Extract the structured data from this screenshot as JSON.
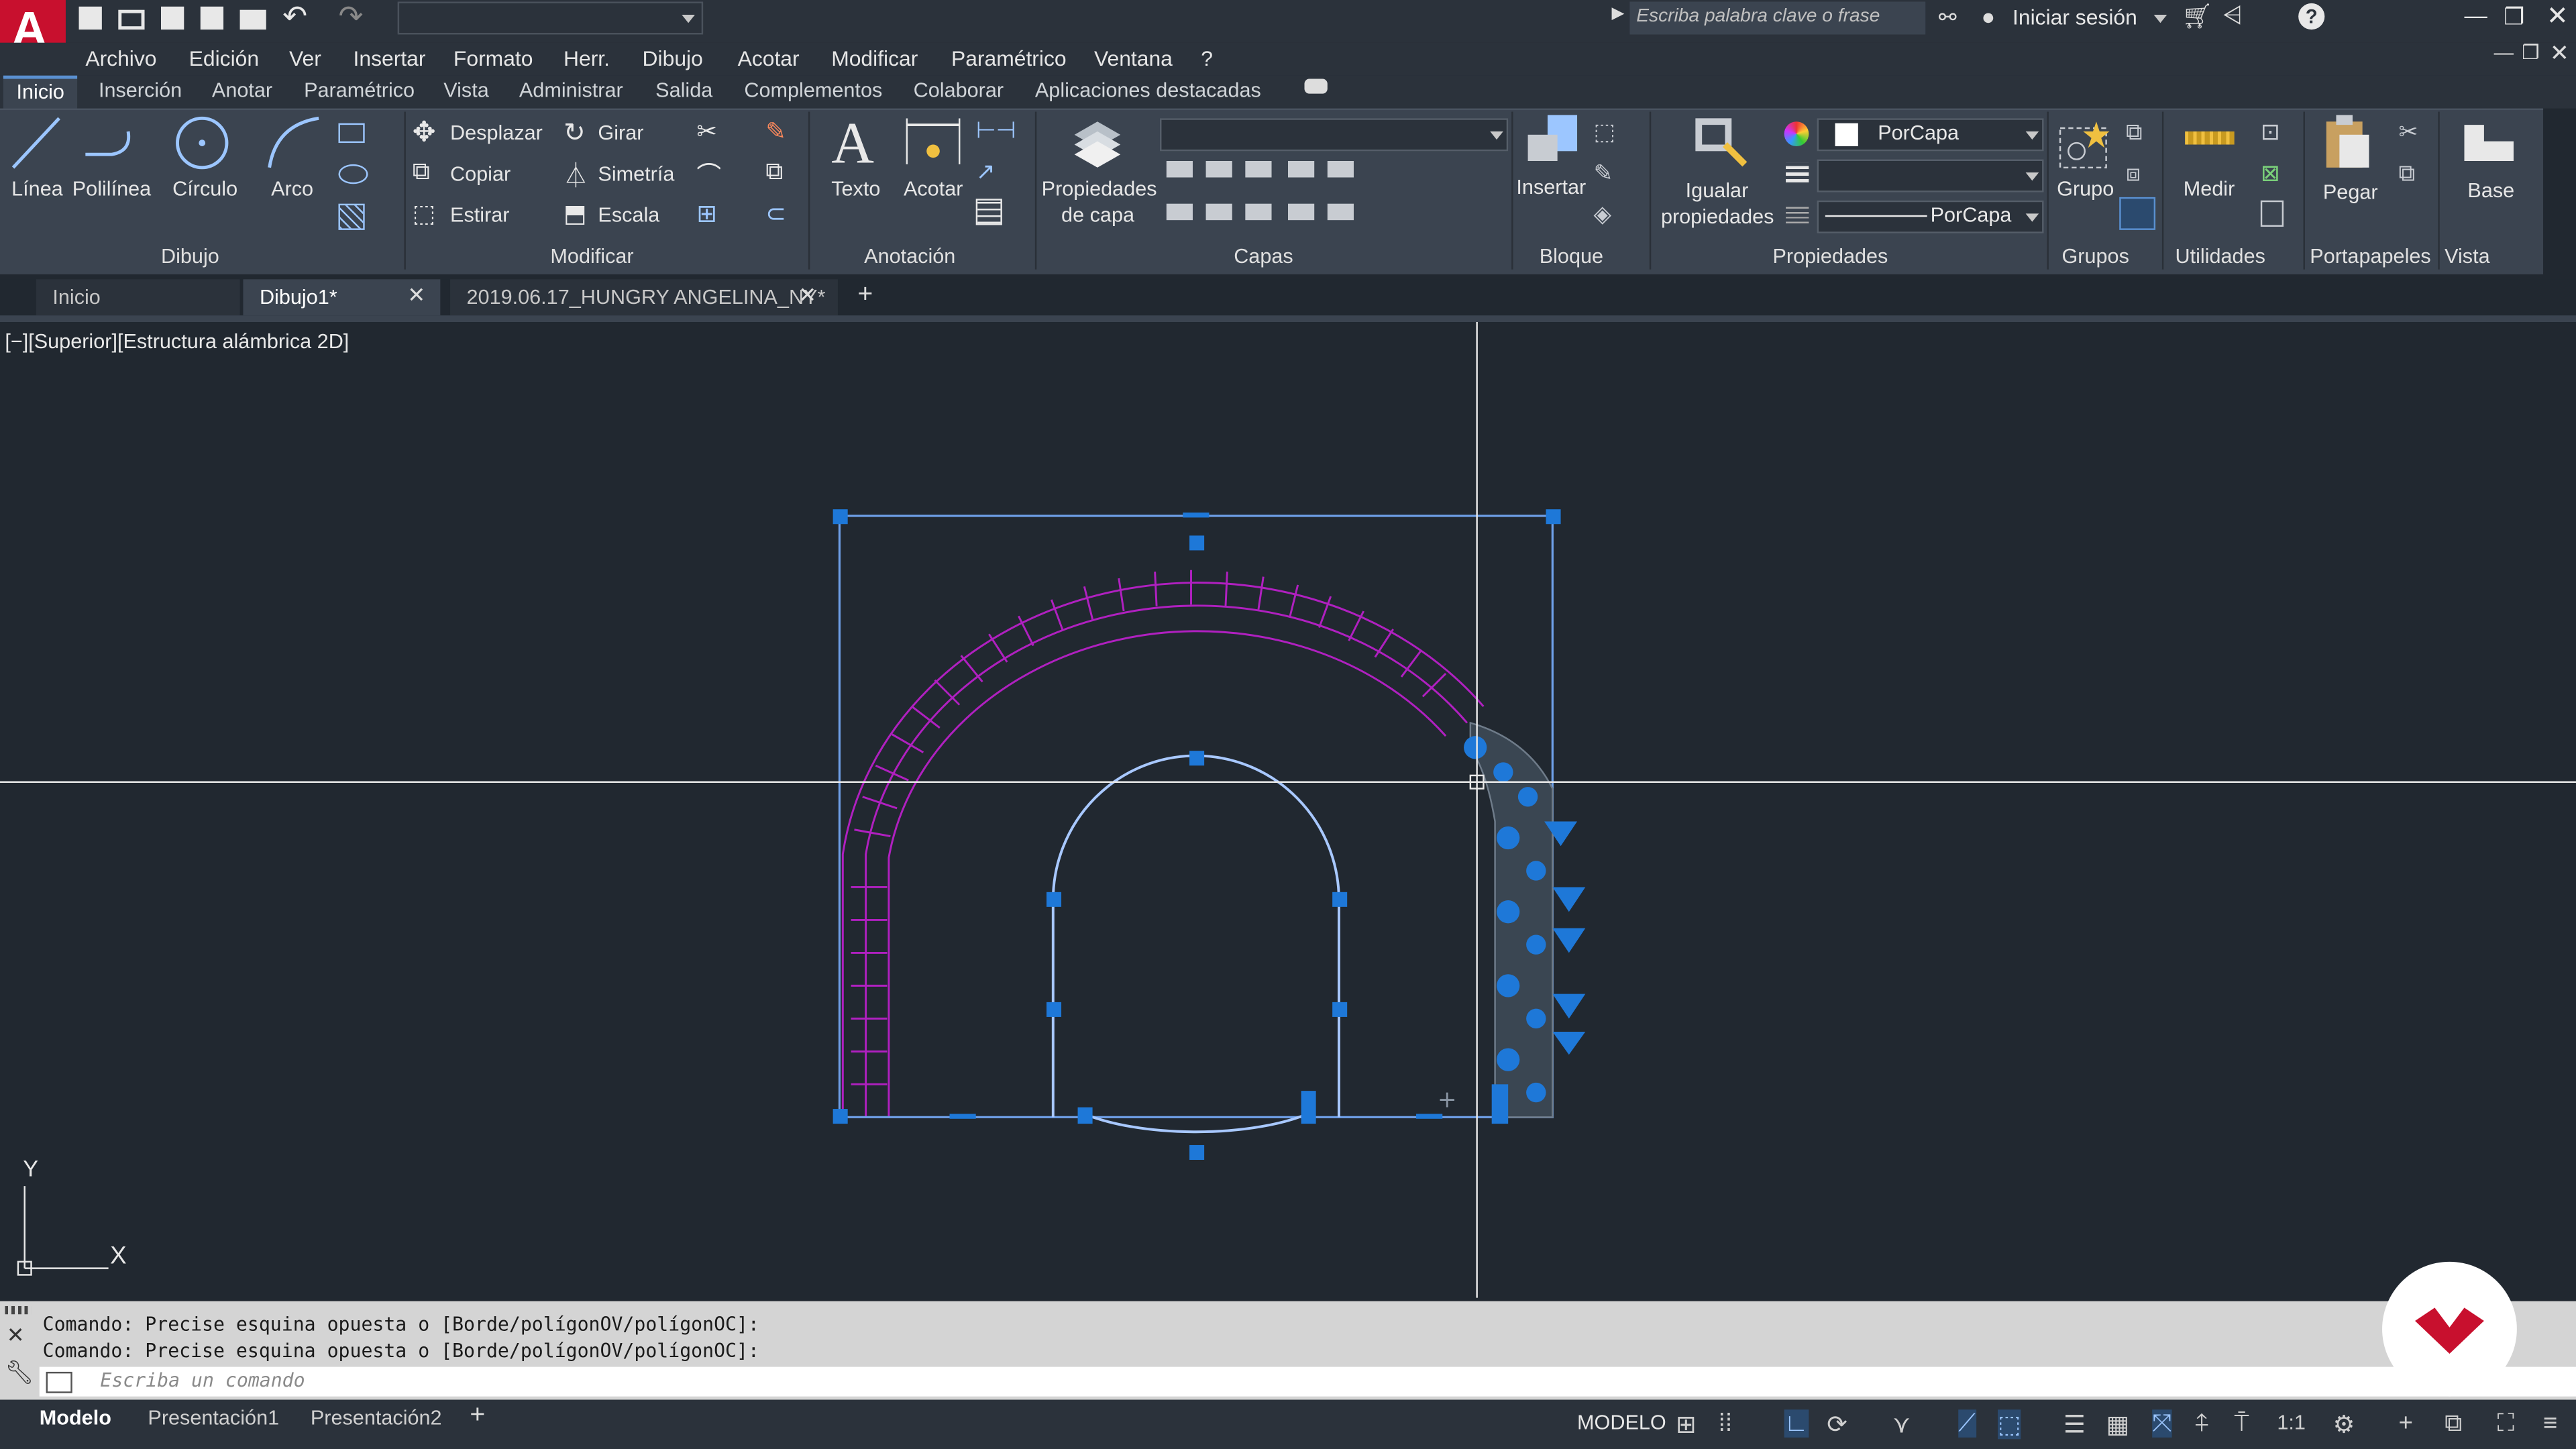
{
  "app": {
    "logo_letter": "A",
    "accent": "#c8102e"
  },
  "titlebar": {
    "search_placeholder": "Escriba palabra clave o frase",
    "signin_label": "Iniciar sesión",
    "help_label": "?"
  },
  "menu": [
    "Archivo",
    "Edición",
    "Ver",
    "Insertar",
    "Formato",
    "Herr.",
    "Dibujo",
    "Acotar",
    "Modificar",
    "Paramétrico",
    "Ventana",
    "?"
  ],
  "ribbon_tabs": [
    "Inicio",
    "Inserción",
    "Anotar",
    "Paramétrico",
    "Vista",
    "Administrar",
    "Salida",
    "Complementos",
    "Colaborar",
    "Aplicaciones destacadas"
  ],
  "ribbon": {
    "draw": {
      "line": "Línea",
      "polyline": "Polilínea",
      "circle": "Círculo",
      "arc": "Arco",
      "panel": "Dibujo"
    },
    "modify": {
      "move": "Desplazar",
      "rotate": "Girar",
      "copy": "Copiar",
      "mirror": "Simetría",
      "stretch": "Estirar",
      "scale": "Escala",
      "panel": "Modificar"
    },
    "annotation": {
      "text": "Texto",
      "dimension": "Acotar",
      "panel": "Anotación"
    },
    "layers": {
      "props_line1": "Propiedades",
      "props_line2": "de capa",
      "panel": "Capas"
    },
    "block": {
      "insert": "Insertar",
      "panel": "Bloque"
    },
    "properties": {
      "match_line1": "Igualar",
      "match_line2": "propiedades",
      "color": "PorCapa",
      "linetype": "PorCapa",
      "panel": "Propiedades"
    },
    "groups": {
      "group": "Grupo",
      "panel": "Grupos"
    },
    "utilities": {
      "measure": "Medir",
      "panel": "Utilidades"
    },
    "clipboard": {
      "paste": "Pegar",
      "panel": "Portapapeles"
    },
    "view": {
      "base": "Base",
      "panel": "Vista"
    }
  },
  "doc_tabs": [
    "Inicio",
    "Dibujo1*",
    "2019.06.17_HUNGRY ANGELINA_NY*"
  ],
  "viewport_label": "[−][Superior][Estructura alámbrica 2D]",
  "ucs": {
    "y": "Y",
    "x": "X"
  },
  "command": {
    "history": [
      "Comando: Precise esquina opuesta o [Borde/polígonOV/polígonOC]:",
      "Comando: Precise esquina opuesta o [Borde/polígonOV/polígonOC]:"
    ],
    "placeholder": "Escriba un comando"
  },
  "layout_tabs": [
    "Modelo",
    "Presentación1",
    "Presentación2"
  ],
  "status": {
    "mode": "MODELO",
    "scale": "1:1"
  },
  "colors": {
    "selection": "#1e78d8",
    "grip": "#1e78d8",
    "arch": "#b020c0",
    "crosshair": "#e8e8e8",
    "background": "#212830"
  }
}
